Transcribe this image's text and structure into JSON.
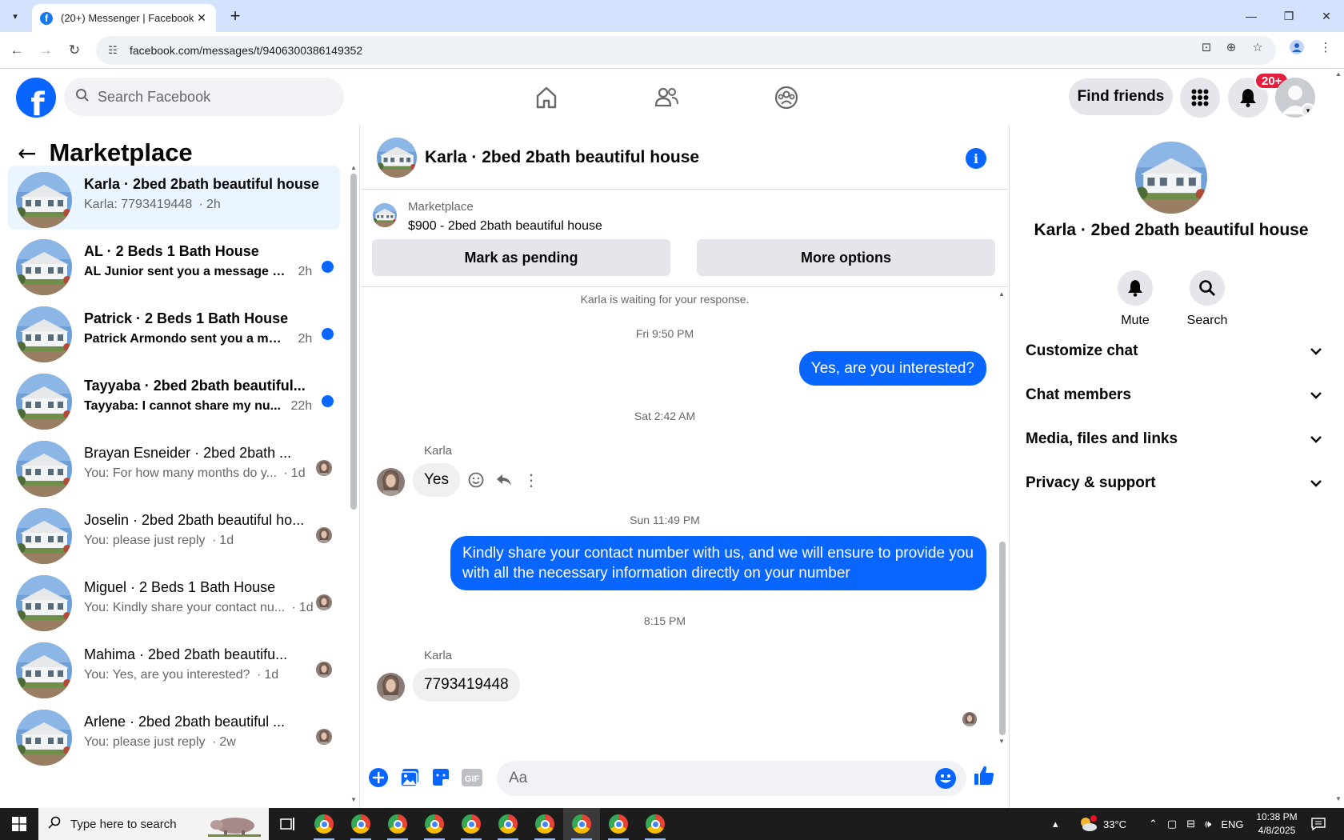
{
  "browser": {
    "tab_title": "(20+) Messenger | Facebook",
    "url": "facebook.com/messages/t/9406300386149352"
  },
  "fb_header": {
    "search_placeholder": "Search Facebook",
    "find_friends_label": "Find friends",
    "notification_badge": "20+"
  },
  "left_panel": {
    "title": "Marketplace",
    "conversations": [
      {
        "title": "Karla · 2bed 2bath beautiful house",
        "preview": "Karla: 7793419448",
        "time": "2h",
        "unread": false,
        "active": true
      },
      {
        "title": "AL · 2 Beds 1 Bath House",
        "preview": "AL Junior sent you a message ab...",
        "time": "2h",
        "unread": true,
        "active": false
      },
      {
        "title": "Patrick · 2 Beds 1 Bath House",
        "preview": "Patrick Armondo sent you a mes...",
        "time": "2h",
        "unread": true,
        "active": false
      },
      {
        "title": "Tayyaba · 2bed 2bath beautiful...",
        "preview": "Tayyaba: I cannot share my nu...",
        "time": "22h",
        "unread": true,
        "active": false
      },
      {
        "title": "Brayan Esneider · 2bed 2bath ...",
        "preview": "You: For how many months do y...",
        "time": "1d",
        "unread": false,
        "active": false
      },
      {
        "title": "Joselin · 2bed 2bath beautiful ho...",
        "preview": "You: please just reply",
        "time": "1d",
        "unread": false,
        "active": false
      },
      {
        "title": "Miguel · 2 Beds 1 Bath House",
        "preview": "You: Kindly share your contact nu...",
        "time": "1d",
        "unread": false,
        "active": false
      },
      {
        "title": "Mahima · 2bed 2bath beautifu...",
        "preview": "You: Yes, are you interested?",
        "time": "1d",
        "unread": false,
        "active": false
      },
      {
        "title": "Arlene · 2bed 2bath beautiful ...",
        "preview": "You: please just reply",
        "time": "2w",
        "unread": false,
        "active": false
      }
    ]
  },
  "chat": {
    "title": "Karla · 2bed 2bath beautiful house",
    "marketplace_label": "Marketplace",
    "listing": "$900 - 2bed 2bath beautiful house",
    "mark_pending_label": "Mark as pending",
    "more_options_label": "More options",
    "waiting_notice": "Karla is waiting for your response.",
    "timestamps": [
      "Fri 9:50 PM",
      "Sat 2:42 AM",
      "Sun 11:49 PM",
      "8:15 PM"
    ],
    "sender_name": "Karla",
    "messages": {
      "out_1": "Yes, are you interested?",
      "in_1": "Yes",
      "out_2": "Kindly share your contact number with us, and we will ensure to provide you with all the necessary information directly on your number",
      "in_2": "7793419448"
    },
    "composer_placeholder": "Aa"
  },
  "right_panel": {
    "name": "Karla · 2bed 2bath beautiful house",
    "mute_label": "Mute",
    "search_label": "Search",
    "sections": [
      "Customize chat",
      "Chat members",
      "Media, files and links",
      "Privacy & support"
    ]
  },
  "taskbar": {
    "search_placeholder": "Type here to search",
    "temperature": "33°C",
    "language": "ENG",
    "time": "10:38 PM",
    "date": "4/8/2025"
  }
}
